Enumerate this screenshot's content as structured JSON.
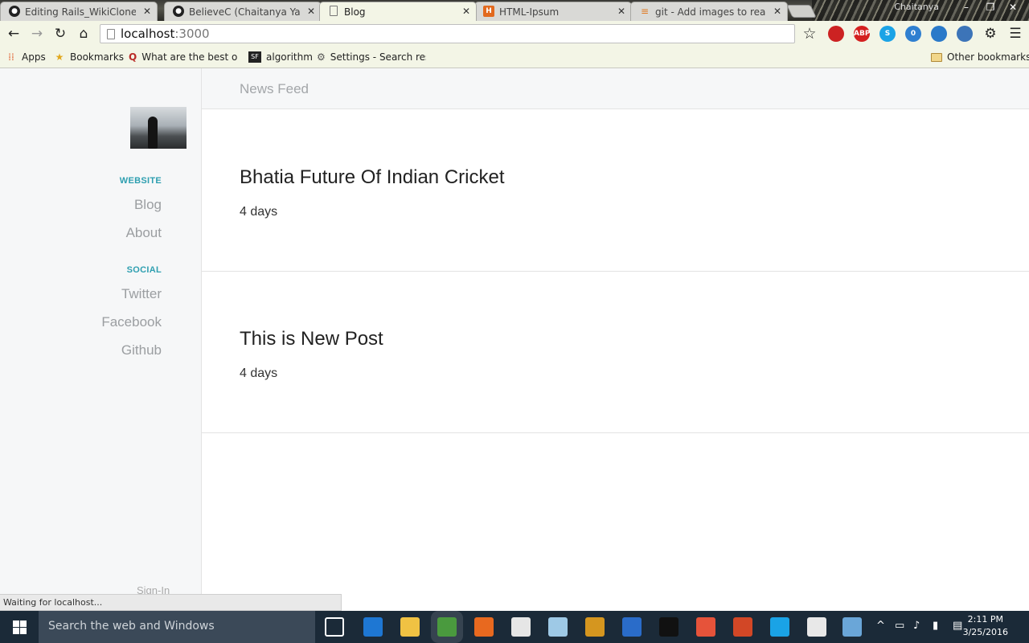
{
  "browser": {
    "tabs": [
      {
        "label": "Editing Rails_WikiClone/R",
        "icon": "github-icon",
        "active": false
      },
      {
        "label": "BelieveC (Chaitanya Yadav",
        "icon": "github-icon",
        "active": false
      },
      {
        "label": "Blog",
        "icon": "page-icon",
        "active": true
      },
      {
        "label": "HTML-Ipsum",
        "icon": "html-ipsum-icon",
        "active": false
      },
      {
        "label": "git - Add images to readm",
        "icon": "stackoverflow-icon",
        "active": false
      }
    ],
    "close_glyph": "✕",
    "profile_name": "Chaitanya",
    "address": {
      "host": "localhost",
      "port": ":3000"
    },
    "bookmarks": [
      {
        "label": "Apps",
        "icon": "apps-grid-icon"
      },
      {
        "label": "Bookmarks",
        "icon": "star-icon"
      },
      {
        "label": "What are the best onli",
        "icon": "quora-icon"
      },
      {
        "label": "algorithm",
        "icon": "sf-icon"
      },
      {
        "label": "Settings - Search resu",
        "icon": "gear-icon"
      },
      {
        "label": "Other bookmarks",
        "icon": "folder-icon"
      }
    ],
    "extensions": [
      {
        "name": "lastpass",
        "color": "#cc2222",
        "text": ""
      },
      {
        "name": "adblock-plus",
        "color": "#d42020",
        "text": "ABP"
      },
      {
        "name": "skype",
        "color": "#1aa3e6",
        "text": "S"
      },
      {
        "name": "notifier",
        "color": "#2f7fd0",
        "text": "0"
      },
      {
        "name": "history",
        "color": "#2a79c9",
        "text": ""
      },
      {
        "name": "downloader",
        "color": "#3c74b8",
        "text": ""
      }
    ],
    "status": "Waiting for localhost..."
  },
  "sidebar": {
    "sections": [
      {
        "heading": "WEBSITE",
        "links": [
          "Blog",
          "About"
        ]
      },
      {
        "heading": "SOCIAL",
        "links": [
          "Twitter",
          "Facebook",
          "Github"
        ]
      }
    ],
    "signin": "Sign-In"
  },
  "main": {
    "header": "News Feed",
    "posts": [
      {
        "title": "Bhatia Future Of Indian Cricket",
        "age": "4 days"
      },
      {
        "title": "This is New Post",
        "age": "4 days"
      }
    ]
  },
  "taskbar": {
    "search_placeholder": "Search the web and Windows",
    "apps": [
      {
        "name": "task-view",
        "color": "#1b2a38"
      },
      {
        "name": "edge",
        "color": "#1e77d3"
      },
      {
        "name": "file-explorer",
        "color": "#f0c243"
      },
      {
        "name": "chrome",
        "color": "#4a9a3e"
      },
      {
        "name": "firefox",
        "color": "#e8691f"
      },
      {
        "name": "camera",
        "color": "#e6e6e6"
      },
      {
        "name": "notes",
        "color": "#9ec9e6"
      },
      {
        "name": "sublime-text",
        "color": "#d5961f"
      },
      {
        "name": "brackets",
        "color": "#2a6cc9"
      },
      {
        "name": "command-prompt",
        "color": "#111111"
      },
      {
        "name": "git",
        "color": "#e6533a"
      },
      {
        "name": "office",
        "color": "#d24726"
      },
      {
        "name": "skype",
        "color": "#1aa3e6"
      },
      {
        "name": "movies",
        "color": "#e8e8e8"
      },
      {
        "name": "paint",
        "color": "#6aa6d8"
      }
    ],
    "time": "2:11 PM",
    "date": "3/25/2016"
  }
}
